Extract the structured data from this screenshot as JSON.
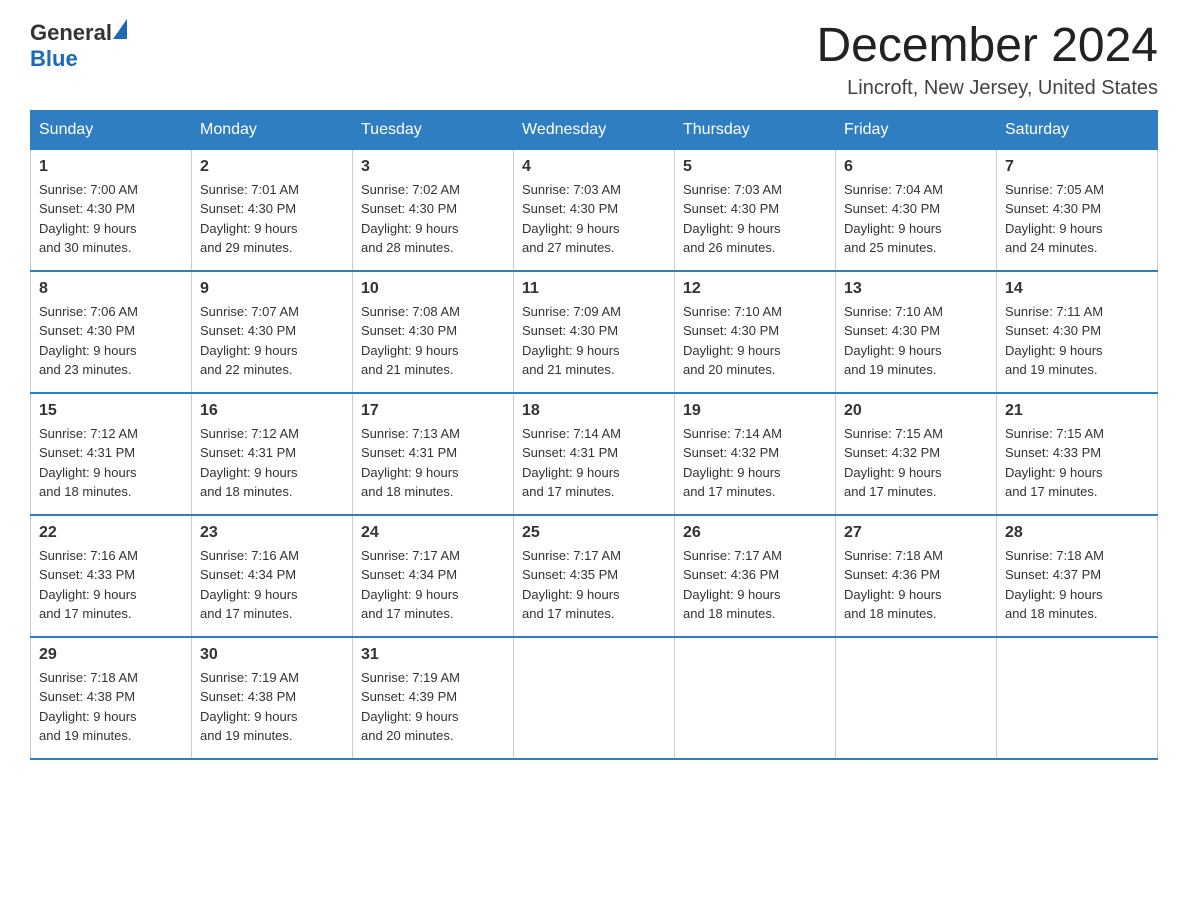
{
  "header": {
    "logo_general": "General",
    "logo_blue": "Blue",
    "title": "December 2024",
    "subtitle": "Lincroft, New Jersey, United States"
  },
  "days_of_week": [
    "Sunday",
    "Monday",
    "Tuesday",
    "Wednesday",
    "Thursday",
    "Friday",
    "Saturday"
  ],
  "weeks": [
    [
      {
        "day": "1",
        "sunrise": "7:00 AM",
        "sunset": "4:30 PM",
        "daylight": "9 hours and 30 minutes."
      },
      {
        "day": "2",
        "sunrise": "7:01 AM",
        "sunset": "4:30 PM",
        "daylight": "9 hours and 29 minutes."
      },
      {
        "day": "3",
        "sunrise": "7:02 AM",
        "sunset": "4:30 PM",
        "daylight": "9 hours and 28 minutes."
      },
      {
        "day": "4",
        "sunrise": "7:03 AM",
        "sunset": "4:30 PM",
        "daylight": "9 hours and 27 minutes."
      },
      {
        "day": "5",
        "sunrise": "7:03 AM",
        "sunset": "4:30 PM",
        "daylight": "9 hours and 26 minutes."
      },
      {
        "day": "6",
        "sunrise": "7:04 AM",
        "sunset": "4:30 PM",
        "daylight": "9 hours and 25 minutes."
      },
      {
        "day": "7",
        "sunrise": "7:05 AM",
        "sunset": "4:30 PM",
        "daylight": "9 hours and 24 minutes."
      }
    ],
    [
      {
        "day": "8",
        "sunrise": "7:06 AM",
        "sunset": "4:30 PM",
        "daylight": "9 hours and 23 minutes."
      },
      {
        "day": "9",
        "sunrise": "7:07 AM",
        "sunset": "4:30 PM",
        "daylight": "9 hours and 22 minutes."
      },
      {
        "day": "10",
        "sunrise": "7:08 AM",
        "sunset": "4:30 PM",
        "daylight": "9 hours and 21 minutes."
      },
      {
        "day": "11",
        "sunrise": "7:09 AM",
        "sunset": "4:30 PM",
        "daylight": "9 hours and 21 minutes."
      },
      {
        "day": "12",
        "sunrise": "7:10 AM",
        "sunset": "4:30 PM",
        "daylight": "9 hours and 20 minutes."
      },
      {
        "day": "13",
        "sunrise": "7:10 AM",
        "sunset": "4:30 PM",
        "daylight": "9 hours and 19 minutes."
      },
      {
        "day": "14",
        "sunrise": "7:11 AM",
        "sunset": "4:30 PM",
        "daylight": "9 hours and 19 minutes."
      }
    ],
    [
      {
        "day": "15",
        "sunrise": "7:12 AM",
        "sunset": "4:31 PM",
        "daylight": "9 hours and 18 minutes."
      },
      {
        "day": "16",
        "sunrise": "7:12 AM",
        "sunset": "4:31 PM",
        "daylight": "9 hours and 18 minutes."
      },
      {
        "day": "17",
        "sunrise": "7:13 AM",
        "sunset": "4:31 PM",
        "daylight": "9 hours and 18 minutes."
      },
      {
        "day": "18",
        "sunrise": "7:14 AM",
        "sunset": "4:31 PM",
        "daylight": "9 hours and 17 minutes."
      },
      {
        "day": "19",
        "sunrise": "7:14 AM",
        "sunset": "4:32 PM",
        "daylight": "9 hours and 17 minutes."
      },
      {
        "day": "20",
        "sunrise": "7:15 AM",
        "sunset": "4:32 PM",
        "daylight": "9 hours and 17 minutes."
      },
      {
        "day": "21",
        "sunrise": "7:15 AM",
        "sunset": "4:33 PM",
        "daylight": "9 hours and 17 minutes."
      }
    ],
    [
      {
        "day": "22",
        "sunrise": "7:16 AM",
        "sunset": "4:33 PM",
        "daylight": "9 hours and 17 minutes."
      },
      {
        "day": "23",
        "sunrise": "7:16 AM",
        "sunset": "4:34 PM",
        "daylight": "9 hours and 17 minutes."
      },
      {
        "day": "24",
        "sunrise": "7:17 AM",
        "sunset": "4:34 PM",
        "daylight": "9 hours and 17 minutes."
      },
      {
        "day": "25",
        "sunrise": "7:17 AM",
        "sunset": "4:35 PM",
        "daylight": "9 hours and 17 minutes."
      },
      {
        "day": "26",
        "sunrise": "7:17 AM",
        "sunset": "4:36 PM",
        "daylight": "9 hours and 18 minutes."
      },
      {
        "day": "27",
        "sunrise": "7:18 AM",
        "sunset": "4:36 PM",
        "daylight": "9 hours and 18 minutes."
      },
      {
        "day": "28",
        "sunrise": "7:18 AM",
        "sunset": "4:37 PM",
        "daylight": "9 hours and 18 minutes."
      }
    ],
    [
      {
        "day": "29",
        "sunrise": "7:18 AM",
        "sunset": "4:38 PM",
        "daylight": "9 hours and 19 minutes."
      },
      {
        "day": "30",
        "sunrise": "7:19 AM",
        "sunset": "4:38 PM",
        "daylight": "9 hours and 19 minutes."
      },
      {
        "day": "31",
        "sunrise": "7:19 AM",
        "sunset": "4:39 PM",
        "daylight": "9 hours and 20 minutes."
      },
      null,
      null,
      null,
      null
    ]
  ],
  "labels": {
    "sunrise": "Sunrise: ",
    "sunset": "Sunset: ",
    "daylight": "Daylight: "
  }
}
